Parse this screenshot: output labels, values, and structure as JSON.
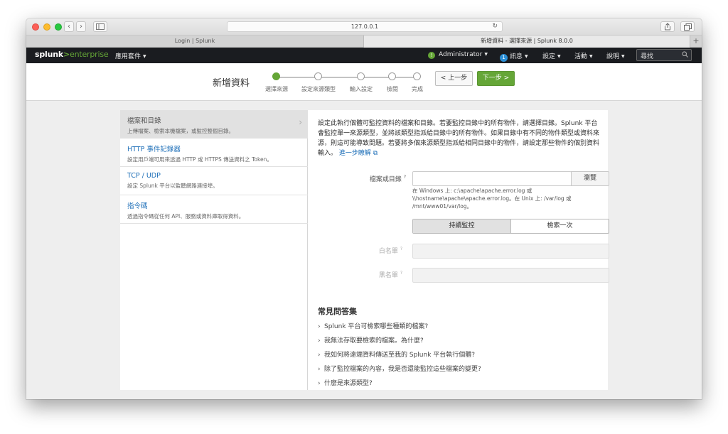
{
  "browser": {
    "url": "127.0.0.1",
    "tabs": [
      {
        "title": "Login | Splunk"
      },
      {
        "title": "新增資料 - 選擇來源 | Splunk 8.0.0"
      }
    ]
  },
  "nav": {
    "logo_main": "splunk",
    "logo_gt": ">",
    "logo_product": "enterprise",
    "apps": "應用套件",
    "admin": "Administrator",
    "admin_badge": "!",
    "messages_count": "1",
    "messages": "訊息",
    "settings": "設定",
    "activity": "活動",
    "help": "說明",
    "search_placeholder": "尋找"
  },
  "wizard": {
    "title": "新增資料",
    "steps": [
      "選擇來源",
      "設定來源類型",
      "輸入設定",
      "檢閱",
      "完成"
    ],
    "back": "< 上一步",
    "next": "下一步 >"
  },
  "sources": [
    {
      "title": "檔案和目錄",
      "desc": "上傳檔案、檢索本機檔案，或監控整個目錄。"
    },
    {
      "title": "HTTP 事件記錄器",
      "desc": "設定用戶端可用來透過 HTTP 或 HTTPS 傳送資料之 Token。"
    },
    {
      "title": "TCP / UDP",
      "desc": "設定 Splunk 平台以監聽網路連接埠。"
    },
    {
      "title": "指令碼",
      "desc": "透過指令碼從任何 API、服務或資料庫取得資料。"
    }
  ],
  "form": {
    "intro": "設定此執行個體可監控資料的檔案和目錄。若要監控目錄中的所有物件，請選擇目錄。Splunk 平台會監控單一來源類型，並將該類型指派給目錄中的所有物件。如果目錄中有不同的物件類型或資料來源，則這可能導致問題。若要將多個來源類型指派給相同目錄中的物件，請設定那些物件的個別資料輸入。",
    "learn_more": "進一步瞭解",
    "file_label": "檔案或目錄",
    "browse": "瀏覽",
    "hint": "在 Windows 上: c:\\apache\\apache.error.log 或 \\\\hostname\\apache\\apache.error.log。在 Unix 上: /var/log 或 /mnt/www01/var/log。",
    "mode_continuous": "持續監控",
    "mode_once": "檢索一次",
    "whitelist_label": "白名單",
    "blacklist_label": "黑名單"
  },
  "faq": {
    "title": "常見問答集",
    "items": [
      "Splunk 平台可檢索哪些種類的檔案?",
      "我無法存取要檢索的檔案。為什麼?",
      "我如何將遠端資料傳送至我的 Splunk 平台執行個體?",
      "除了監控檔案的內容，我是否還能監控這些檔案的變更?",
      "什麼是來源類型?"
    ]
  }
}
